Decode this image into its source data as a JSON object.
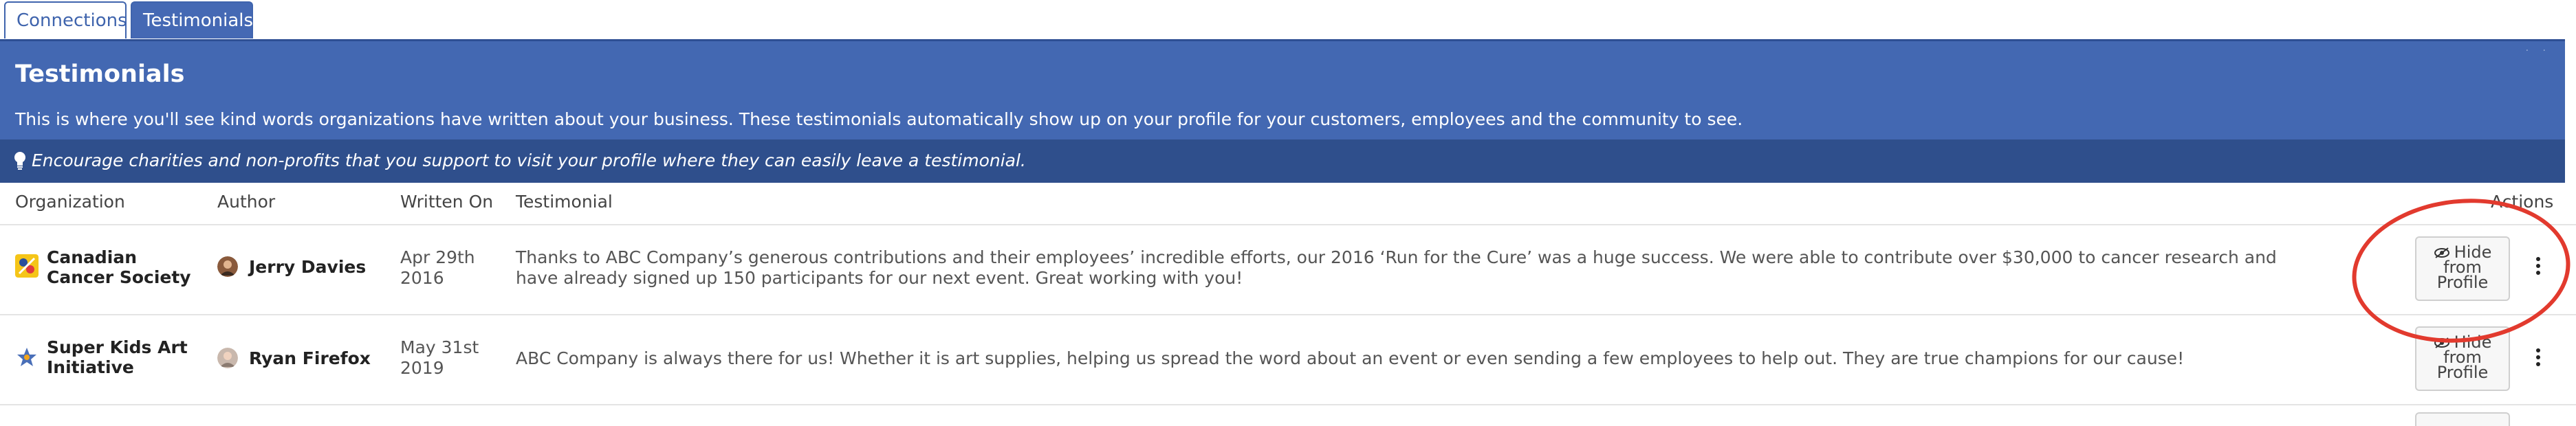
{
  "tabs": [
    {
      "label": "Connections"
    },
    {
      "label": "Testimonials"
    }
  ],
  "header": {
    "title": "Testimonials",
    "description": "This is where you'll see kind words organizations have written about your business. These testimonials automatically show up on your profile for your customers, employees and the community to see.",
    "tip_icon": "lightbulb-icon",
    "tip": "Encourage charities and non-profits that you support to visit your profile where they can easily leave a testimonial."
  },
  "table": {
    "columns": {
      "organization": "Organization",
      "author": "Author",
      "written_on": "Written On",
      "testimonial": "Testimonial",
      "actions": "Actions"
    },
    "rows": [
      {
        "organization": "Canadian Cancer Society",
        "author": "Jerry Davies",
        "written_on": "Apr 29th 2016",
        "testimonial": "Thanks to ABC Company’s generous contributions and their employees’ incredible efforts, our 2016 ‘Run for the Cure’ was a huge success. We were able to contribute over $30,000 to cancer research and have already signed up 150 participants for our next event. Great working with you!",
        "action_label": "Hide from Profile"
      },
      {
        "organization": "Super Kids Art Initiative",
        "author": "Ryan Firefox",
        "written_on": "May 31st 2019",
        "testimonial": "ABC Company is always there for us! Whether it is art supplies, helping us spread the word about an event or even sending a few employees to help out. They are true champions for our cause!",
        "action_label": "Hide from Profile"
      }
    ]
  },
  "colors": {
    "header_bg": "#4368b2",
    "tip_bg": "#2f4f8c",
    "annotation": "#e23a2e"
  }
}
